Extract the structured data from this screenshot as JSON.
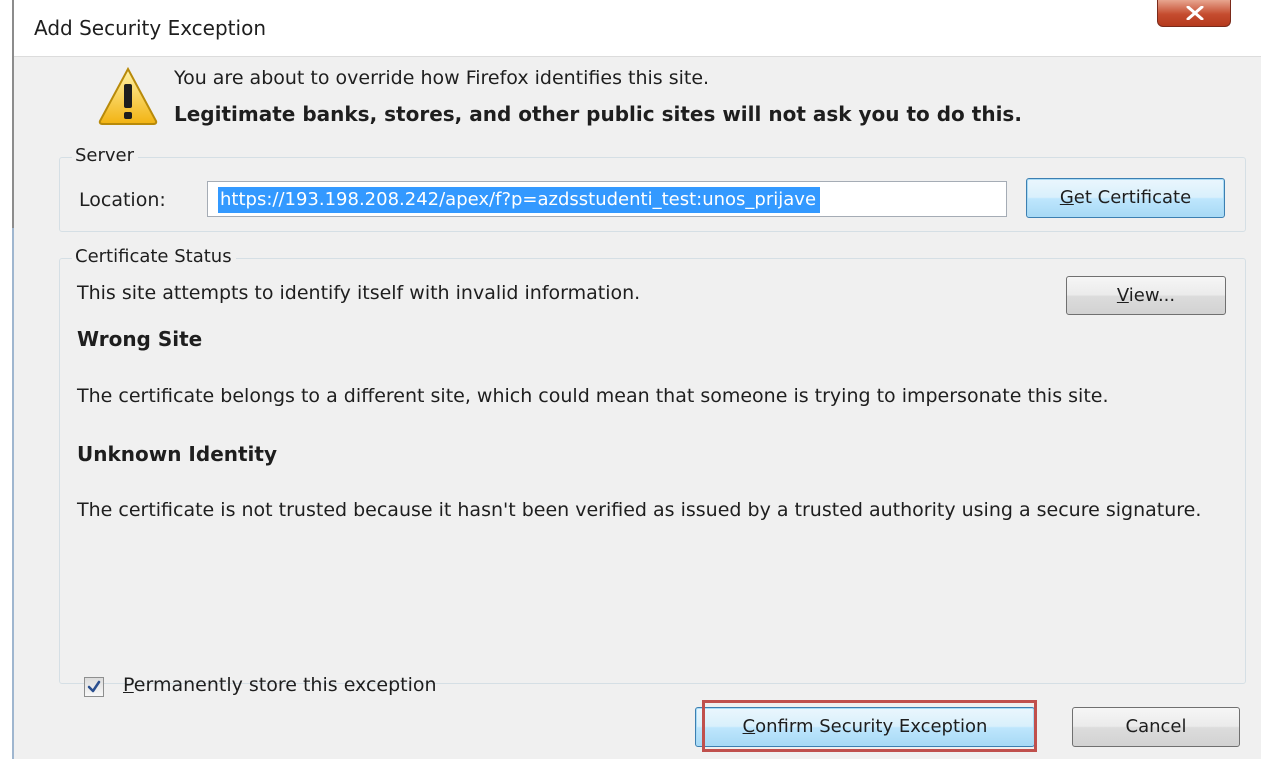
{
  "window": {
    "title": "Add Security Exception",
    "close_icon": "close-icon"
  },
  "warning": {
    "icon": "warning-icon",
    "line1": "You are about to override how Firefox identifies this site.",
    "line2": "Legitimate banks, stores, and other public sites will not ask you to do this."
  },
  "server": {
    "group_label": "Server",
    "location_label": "Location:",
    "location_value": "https://193.198.208.242/apex/f?p=azdsstudenti_test:unos_prijave",
    "get_certificate_label": "Get Certificate"
  },
  "status": {
    "group_label": "Certificate Status",
    "message": "This site attempts to identify itself with invalid information.",
    "view_label": "View...",
    "wrong_site_heading": "Wrong Site",
    "wrong_site_text": "The certificate belongs to a different site, which could mean that someone is trying to impersonate this site.",
    "unknown_identity_heading": "Unknown Identity",
    "unknown_identity_text": "The certificate is not trusted because it hasn't been verified as issued by a trusted authority using a secure signature."
  },
  "permanent": {
    "label": "Permanently store this exception",
    "checked": true
  },
  "buttons": {
    "confirm_label": "Confirm Security Exception",
    "cancel_label": "Cancel"
  },
  "colors": {
    "selection": "#3399ff",
    "highlight_box": "#c0504d",
    "close_button": "#c54c2f"
  }
}
